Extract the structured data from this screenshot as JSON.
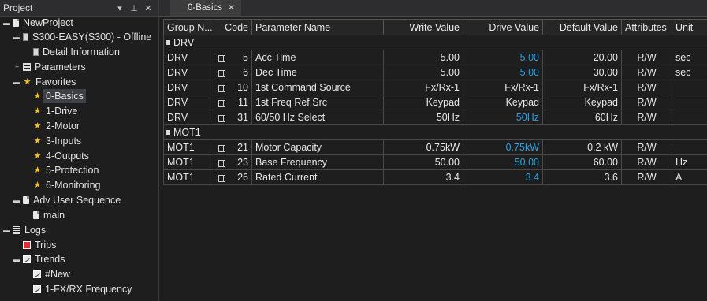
{
  "project": {
    "title": "Project",
    "pin_glyph": "▾",
    "pushpin_glyph": "⊥",
    "close_glyph": "✕",
    "tree": [
      {
        "label": "NewProject",
        "icon": "document-icon",
        "expander": "▬"
      },
      {
        "label": "S300-EASY(S300) - Offline",
        "icon": "device-icon",
        "expander": "▬"
      },
      {
        "label": "Detail Information",
        "icon": "device-icon",
        "expander": ""
      },
      {
        "label": "Parameters",
        "icon": "grid-icon",
        "expander": "+"
      },
      {
        "label": "Favorites",
        "icon": "star-icon",
        "expander": "▬"
      },
      {
        "label": "0-Basics",
        "icon": "star-icon",
        "expander": ""
      },
      {
        "label": "1-Drive",
        "icon": "star-icon",
        "expander": ""
      },
      {
        "label": "2-Motor",
        "icon": "star-icon",
        "expander": ""
      },
      {
        "label": "3-Inputs",
        "icon": "star-icon",
        "expander": ""
      },
      {
        "label": "4-Outputs",
        "icon": "star-icon",
        "expander": ""
      },
      {
        "label": "5-Protection",
        "icon": "star-icon",
        "expander": ""
      },
      {
        "label": "6-Monitoring",
        "icon": "star-icon",
        "expander": ""
      },
      {
        "label": "Adv User Sequence",
        "icon": "document-icon",
        "expander": "▬"
      },
      {
        "label": "main",
        "icon": "document-icon",
        "expander": ""
      },
      {
        "label": "Logs",
        "icon": "list-icon",
        "expander": "▬"
      },
      {
        "label": "Trips",
        "icon": "trip-icon",
        "expander": ""
      },
      {
        "label": "Trends",
        "icon": "trend-icon",
        "expander": "▬"
      },
      {
        "label": "#New",
        "icon": "trend-icon",
        "expander": ""
      },
      {
        "label": "1-FX/RX Frequency",
        "icon": "trend-icon",
        "expander": ""
      }
    ]
  },
  "tab": {
    "label": "0-Basics",
    "close": "✕"
  },
  "grid": {
    "columns": [
      "Group N...",
      "Code",
      "Parameter Name",
      "Write Value",
      "Drive Value",
      "Default Value",
      "Attributes",
      "Unit"
    ],
    "groups": [
      {
        "name": "DRV",
        "rows": [
          {
            "group": "DRV",
            "code": "5",
            "name": "Acc Time",
            "write": "5.00",
            "drive": "5.00",
            "drive_highlight": true,
            "default": "20.00",
            "attr": "R/W",
            "unit": "sec"
          },
          {
            "group": "DRV",
            "code": "6",
            "name": "Dec Time",
            "write": "5.00",
            "drive": "5.00",
            "drive_highlight": true,
            "default": "30.00",
            "attr": "R/W",
            "unit": "sec"
          },
          {
            "group": "DRV",
            "code": "10",
            "name": "1st Command Source",
            "write": "Fx/Rx-1",
            "drive": "Fx/Rx-1",
            "drive_highlight": false,
            "default": "Fx/Rx-1",
            "attr": "R/W",
            "unit": ""
          },
          {
            "group": "DRV",
            "code": "11",
            "name": "1st Freq Ref Src",
            "write": "Keypad",
            "drive": "Keypad",
            "drive_highlight": false,
            "default": "Keypad",
            "attr": "R/W",
            "unit": ""
          },
          {
            "group": "DRV",
            "code": "31",
            "name": "60/50 Hz Select",
            "write": "50Hz",
            "drive": "50Hz",
            "drive_highlight": true,
            "default": "60Hz",
            "attr": "R/W",
            "unit": ""
          }
        ]
      },
      {
        "name": "MOT1",
        "rows": [
          {
            "group": "MOT1",
            "code": "21",
            "name": "Motor Capacity",
            "write": "0.75kW",
            "drive": "0.75kW",
            "drive_highlight": true,
            "default": "0.2 kW",
            "attr": "R/W",
            "unit": ""
          },
          {
            "group": "MOT1",
            "code": "23",
            "name": "Base Frequency",
            "write": "50.00",
            "drive": "50.00",
            "drive_highlight": true,
            "default": "60.00",
            "attr": "R/W",
            "unit": "Hz"
          },
          {
            "group": "MOT1",
            "code": "26",
            "name": "Rated Current",
            "write": "3.4",
            "drive": "3.4",
            "drive_highlight": true,
            "default": "3.6",
            "attr": "R/W",
            "unit": "A"
          }
        ]
      }
    ]
  },
  "colors": {
    "background": "#1e1e1e",
    "drive_value_highlight": "#2aa0e0",
    "favorite_star": "#f0c020"
  }
}
